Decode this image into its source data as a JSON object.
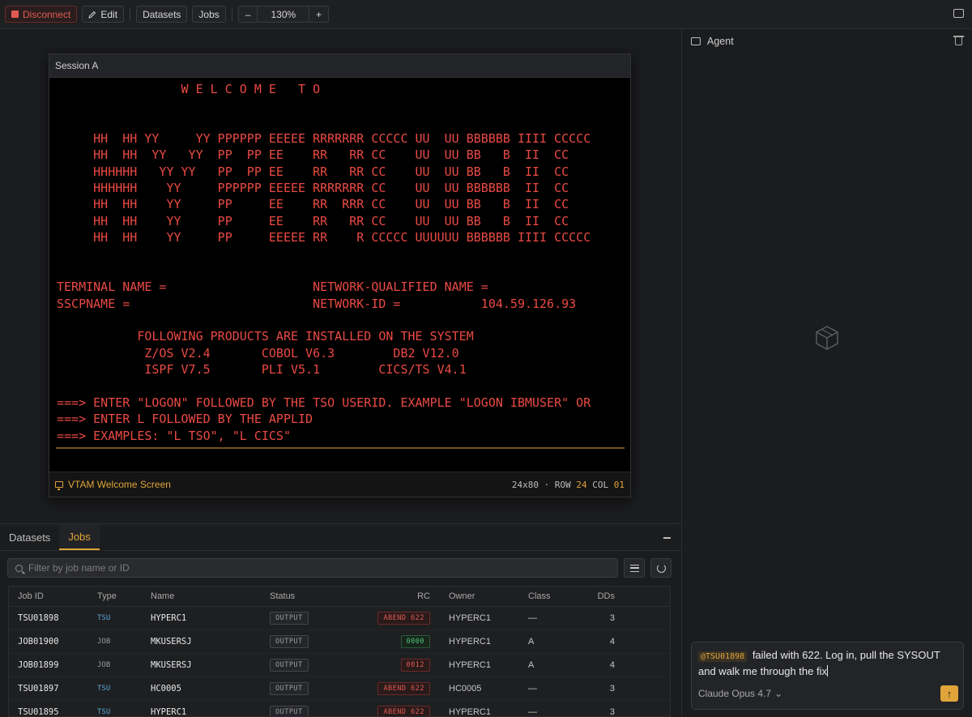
{
  "toolbar": {
    "disconnect_label": "Disconnect",
    "edit_label": "Edit",
    "datasets_label": "Datasets",
    "jobs_label": "Jobs",
    "zoom_minus": "–",
    "zoom_value": "130%",
    "zoom_plus": "+"
  },
  "session": {
    "title": "Session A",
    "screen_lines": [
      "                 W E L C O M E   T O",
      "",
      "",
      "     HH  HH YY     YY PPPPPP EEEEE RRRRRRR CCCCC UU  UU BBBBBB IIII CCCCC",
      "     HH  HH  YY   YY  PP  PP EE    RR   RR CC    UU  UU BB   B  II  CC",
      "     HHHHHH   YY YY   PP  PP EE    RR   RR CC    UU  UU BB   B  II  CC",
      "     HHHHHH    YY     PPPPPP EEEEE RRRRRRR CC    UU  UU BBBBBB  II  CC",
      "     HH  HH    YY     PP     EE    RR  RRR CC    UU  UU BB   B  II  CC",
      "     HH  HH    YY     PP     EE    RR   RR CC    UU  UU BB   B  II  CC",
      "     HH  HH    YY     PP     EEEEE RR    R CCCCC UUUUUU BBBBBB IIII CCCCC",
      "",
      "",
      "TERMINAL NAME =                    NETWORK-QUALIFIED NAME =",
      "SSCPNAME =                         NETWORK-ID =           104.59.126.93",
      "",
      "           FOLLOWING PRODUCTS ARE INSTALLED ON THE SYSTEM",
      "            Z/OS V2.4       COBOL V6.3        DB2 V12.0",
      "            ISPF V7.5       PLI V5.1        CICS/TS V4.1",
      "",
      "===> ENTER \"LOGON\" FOLLOWED BY THE TSO USERID. EXAMPLE \"LOGON IBMUSER\" OR",
      "===> ENTER L FOLLOWED BY THE APPLID",
      "===> EXAMPLES: \"L TSO\", \"L CICS\""
    ],
    "footer_label": "VTAM Welcome Screen",
    "dims": "24x80",
    "row_label": "ROW",
    "row_value": "24",
    "col_label": "COL",
    "col_value": "01"
  },
  "bottom": {
    "tabs": [
      "Datasets",
      "Jobs"
    ],
    "active_tab": "Jobs",
    "filter_placeholder": "Filter by job name or ID",
    "columns": [
      "Job ID",
      "Type",
      "Name",
      "Status",
      "RC",
      "Owner",
      "Class",
      "DDs"
    ],
    "rows": [
      {
        "id": "TSU01898",
        "type": "TSU",
        "name": "HYPERC1",
        "status": "OUTPUT",
        "rc": "ABEND 622",
        "rc_kind": "abend",
        "owner": "HYPERC1",
        "class": "—",
        "dds": "3"
      },
      {
        "id": "JOB01900",
        "type": "JOB",
        "name": "MKUSERSJ",
        "status": "OUTPUT",
        "rc": "0000",
        "rc_kind": "ok",
        "owner": "HYPERC1",
        "class": "A",
        "dds": "4"
      },
      {
        "id": "JOB01899",
        "type": "JOB",
        "name": "MKUSERSJ",
        "status": "OUTPUT",
        "rc": "0012",
        "rc_kind": "abend",
        "owner": "HYPERC1",
        "class": "A",
        "dds": "4"
      },
      {
        "id": "TSU01897",
        "type": "TSU",
        "name": "HC0005",
        "status": "OUTPUT",
        "rc": "ABEND 622",
        "rc_kind": "abend",
        "owner": "HC0005",
        "class": "—",
        "dds": "3"
      },
      {
        "id": "TSU01895",
        "type": "TSU",
        "name": "HYPERC1",
        "status": "OUTPUT",
        "rc": "ABEND 622",
        "rc_kind": "abend",
        "owner": "HYPERC1",
        "class": "—",
        "dds": "3"
      }
    ]
  },
  "agent": {
    "title": "Agent",
    "mention": "@TSU01898",
    "message": "failed with 622. Log in, pull the SYSOUT and walk me through the fix",
    "model": "Claude Opus 4.7",
    "model_chevron": "⌄",
    "send_icon": "↑"
  },
  "colors": {
    "accent": "#e0a43a",
    "terminal_text": "#ea4a44",
    "error": "#e05a52",
    "success": "#4fc27a",
    "tsu_type": "#5aa7d8"
  },
  "icons": [
    "stop-icon",
    "pencil-icon",
    "chat-icon",
    "monitor-icon",
    "search-icon",
    "sliders-icon",
    "refresh-icon",
    "minimize-icon",
    "message-icon",
    "trash-icon",
    "cube-icon",
    "arrow-up-icon"
  ]
}
